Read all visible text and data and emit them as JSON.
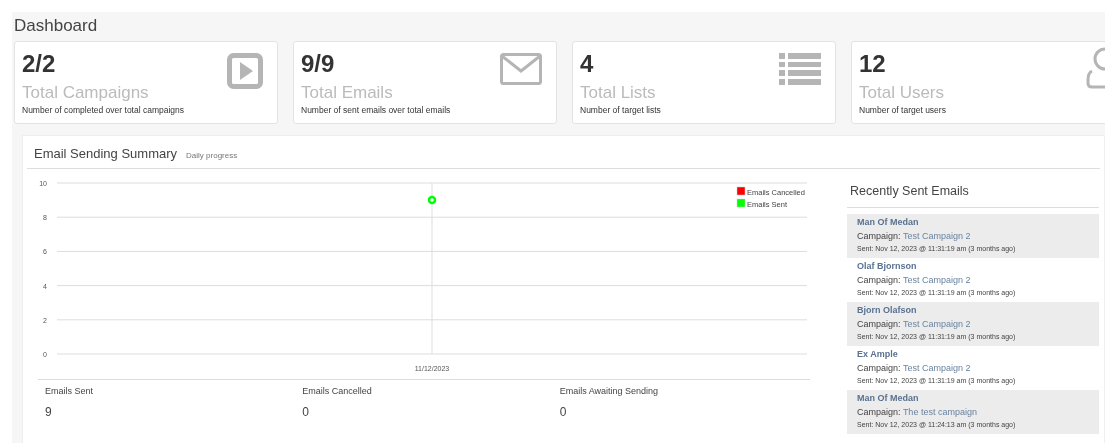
{
  "page": {
    "title": "Dashboard"
  },
  "stat_cards": [
    {
      "value": "2/2",
      "label": "Total Campaigns",
      "description": "Number of completed over total campaigns",
      "kind": "play"
    },
    {
      "value": "9/9",
      "label": "Total Emails",
      "description": "Number of sent emails over total emails",
      "kind": "envelope"
    },
    {
      "value": "4",
      "label": "Total Lists",
      "description": "Number of target lists",
      "kind": "list"
    },
    {
      "value": "12",
      "label": "Total Users",
      "description": "Number of target users",
      "kind": "user"
    }
  ],
  "summary": {
    "title": "Email Sending Summary",
    "subtitle": "Daily progress",
    "chart_data": {
      "type": "line",
      "grid": true,
      "categories": [
        "11/12/2023"
      ],
      "ylim": [
        0,
        10
      ],
      "yticks": [
        0,
        2,
        4,
        6,
        8,
        10
      ],
      "series": [
        {
          "name": "Emails Cancelled",
          "color": "#ff0000",
          "values": [
            null
          ]
        },
        {
          "name": "Emails Sent",
          "color": "#00ff00",
          "marker": "circle",
          "values": [
            9
          ]
        }
      ]
    },
    "totals": [
      {
        "label": "Emails Sent",
        "value": "9"
      },
      {
        "label": "Emails Cancelled",
        "value": "0"
      },
      {
        "label": "Emails Awaiting Sending",
        "value": "0"
      }
    ]
  },
  "recent": {
    "title": "Recently Sent Emails",
    "items": [
      {
        "name": "Man Of Medan",
        "campaign_label": "Campaign:",
        "campaign": "Test Campaign 2",
        "sent": "Sent: Nov 12, 2023 @ 11:31:19 am (3 months ago)"
      },
      {
        "name": "Olaf Bjornson",
        "campaign_label": "Campaign:",
        "campaign": "Test Campaign 2",
        "sent": "Sent: Nov 12, 2023 @ 11:31:19 am (3 months ago)"
      },
      {
        "name": "Bjorn Olafson",
        "campaign_label": "Campaign:",
        "campaign": "Test Campaign 2",
        "sent": "Sent: Nov 12, 2023 @ 11:31:19 am (3 months ago)"
      },
      {
        "name": "Ex Ample",
        "campaign_label": "Campaign:",
        "campaign": "Test Campaign 2",
        "sent": "Sent: Nov 12, 2023 @ 11:31:19 am (3 months ago)"
      },
      {
        "name": "Man Of Medan",
        "campaign_label": "Campaign:",
        "campaign": "The test campaign",
        "sent": "Sent: Nov 12, 2023 @ 11:24:13 am (3 months ago)"
      }
    ]
  }
}
